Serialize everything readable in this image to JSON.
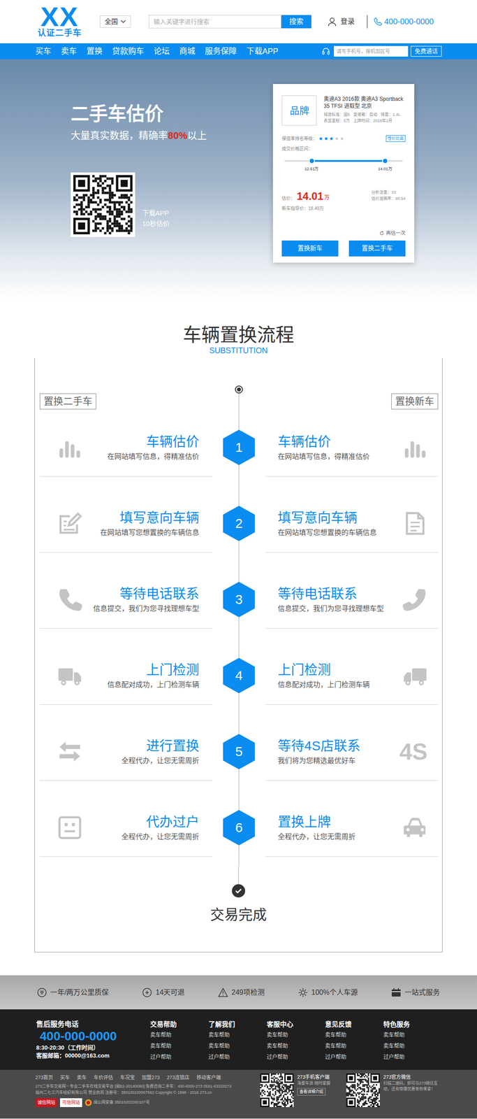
{
  "header": {
    "logo": "XX",
    "logo_sub": "认证二手车",
    "region": "全国",
    "search_placeholder": "输入关键字进行搜索",
    "search_button": "搜索",
    "login": "登录",
    "phone": "400-000-0000"
  },
  "nav": {
    "items": [
      "买车",
      "卖车",
      "置换",
      "贷款购车",
      "论坛",
      "商城",
      "服务保障",
      "下载APP"
    ],
    "call_placeholder": "请写手机号，接机加区号",
    "call_button": "免费通话"
  },
  "hero": {
    "title": "二手车估价",
    "subtitle_before": "大量真实数据，精确率",
    "subtitle_highlight": "80%",
    "subtitle_after": "以上",
    "app_lines": [
      "下载APP",
      "10秒估价"
    ]
  },
  "card": {
    "brand": "品牌",
    "title": "奥迪A3 2016款 奥迪A3 Sportback 35 TFSI 进取型 北京",
    "specs": [
      "排放标准：国5",
      "变速箱：自动",
      "排量：1.4L",
      "表显里程：5万",
      "上牌时间：2016年2月"
    ],
    "rating_label": "保值率排名等级：",
    "stars": 3,
    "tag": "性价比高",
    "range_label": "成交价格区间：",
    "range": {
      "low": 0.23,
      "high": 0.85,
      "low_label": "12.61万",
      "high_label": "14.01万"
    },
    "price_label": "估价：",
    "price": "14.01",
    "price_unit": "万",
    "stats": [
      "分析流量：33",
      "估价准确率：80.54"
    ],
    "new_price": "新车指导价：18.49万",
    "retry": "再估一次",
    "buttons": [
      "置换新车",
      "置换二手车"
    ]
  },
  "process": {
    "title": "车辆置换流程",
    "subtitle": "SUBSTITUTION",
    "left_label": "置换二手车",
    "right_label": "置换新车",
    "steps": [
      {
        "number": "1",
        "left": {
          "title": "车辆估价",
          "desc": "在网站填写信息，得精准估价"
        },
        "right": {
          "title": "车辆估价",
          "desc": "在网站填写信息，得精准估价",
          "kind": "icon"
        }
      },
      {
        "number": "2",
        "left": {
          "title": "填写意向车辆",
          "desc": "在网站填写您想置换的车辆信息"
        },
        "right": {
          "title": "填写意向车辆",
          "desc": "在网站填写您想置换的车辆信息",
          "kind": "icon"
        }
      },
      {
        "number": "3",
        "left": {
          "title": "等待电话联系",
          "desc": "信息提交，我们为您寻找理想车型"
        },
        "right": {
          "title": "等待电话联系",
          "desc": "信息提交，我们为您寻找理想车型",
          "kind": "icon"
        }
      },
      {
        "number": "4",
        "left": {
          "title": "上门检测",
          "desc": "信息配对成功，上门检测车辆"
        },
        "right": {
          "title": "上门检测",
          "desc": "信息配对成功，上门检测车辆",
          "kind": "icon"
        }
      },
      {
        "number": "5",
        "left": {
          "title": "进行置换",
          "desc": "全程代办，让您无需周折"
        },
        "right": {
          "title": "等待4S店联系",
          "desc": "我们将为您精选最优好车",
          "kind": "text",
          "icon_text": "4S"
        }
      },
      {
        "number": "6",
        "left": {
          "title": "代办过户",
          "desc": "全程代办，让您无需周折"
        },
        "right": {
          "title": "置换上牌",
          "desc": "全程代办，让您无需周折",
          "kind": "icon"
        }
      }
    ],
    "done": "交易完成"
  },
  "features": [
    "一年/两万公里质保",
    "14天可退",
    "249项检测",
    "100%个人车源",
    "一站式服务"
  ],
  "footer": {
    "hotline_label": "售后服务电话",
    "hotline": "400-000-0000",
    "hours": "8:30-20:30（工作时间）",
    "email": "客服邮箱：00000@163.com",
    "columns": [
      {
        "title": "交易帮助",
        "links": [
          "卖车帮助",
          "卖车帮助",
          "过户帮助"
        ]
      },
      {
        "title": "了解我们",
        "links": [
          "卖车帮助",
          "卖车帮助",
          "过户帮助"
        ]
      },
      {
        "title": "客服中心",
        "links": [
          "卖车帮助",
          "卖车帮助",
          "过户帮助"
        ]
      },
      {
        "title": "意见反馈",
        "links": [
          "卖车帮助",
          "卖车帮助",
          "过户帮助"
        ]
      },
      {
        "title": "特色服务",
        "links": [
          "卖车帮助",
          "卖车帮助",
          "过户帮助"
        ]
      }
    ]
  },
  "bottom": {
    "links": [
      "273首页",
      "买车",
      "卖车",
      "车价评估",
      "车况宝",
      "加盟273",
      "273连锁店",
      "移动客户端"
    ],
    "lines": [
      "273二手车交易网－专业二手车在线交易平台 [闽B2-20140080] 免费咨询二手车：400-6000-273 0591-63333273",
      "福州二七三汽车经纪有限公司 营业执照 注册号：350100100067582 Copyright © 1998 - 2016 273.cn"
    ],
    "badges": [
      "诚信网站",
      "可信网站"
    ],
    "police": "闽公网安备 35010202000107号",
    "apps": [
      {
        "title": "273手机客户端",
        "lines": [
          "海量车源 随时掌握"
        ],
        "button": "查看详细介绍"
      },
      {
        "title": "273官方微信",
        "lines": [
          "扫描二维码，即可与273微信互动，还有惊爆优惠等你来拿！"
        ]
      }
    ]
  }
}
